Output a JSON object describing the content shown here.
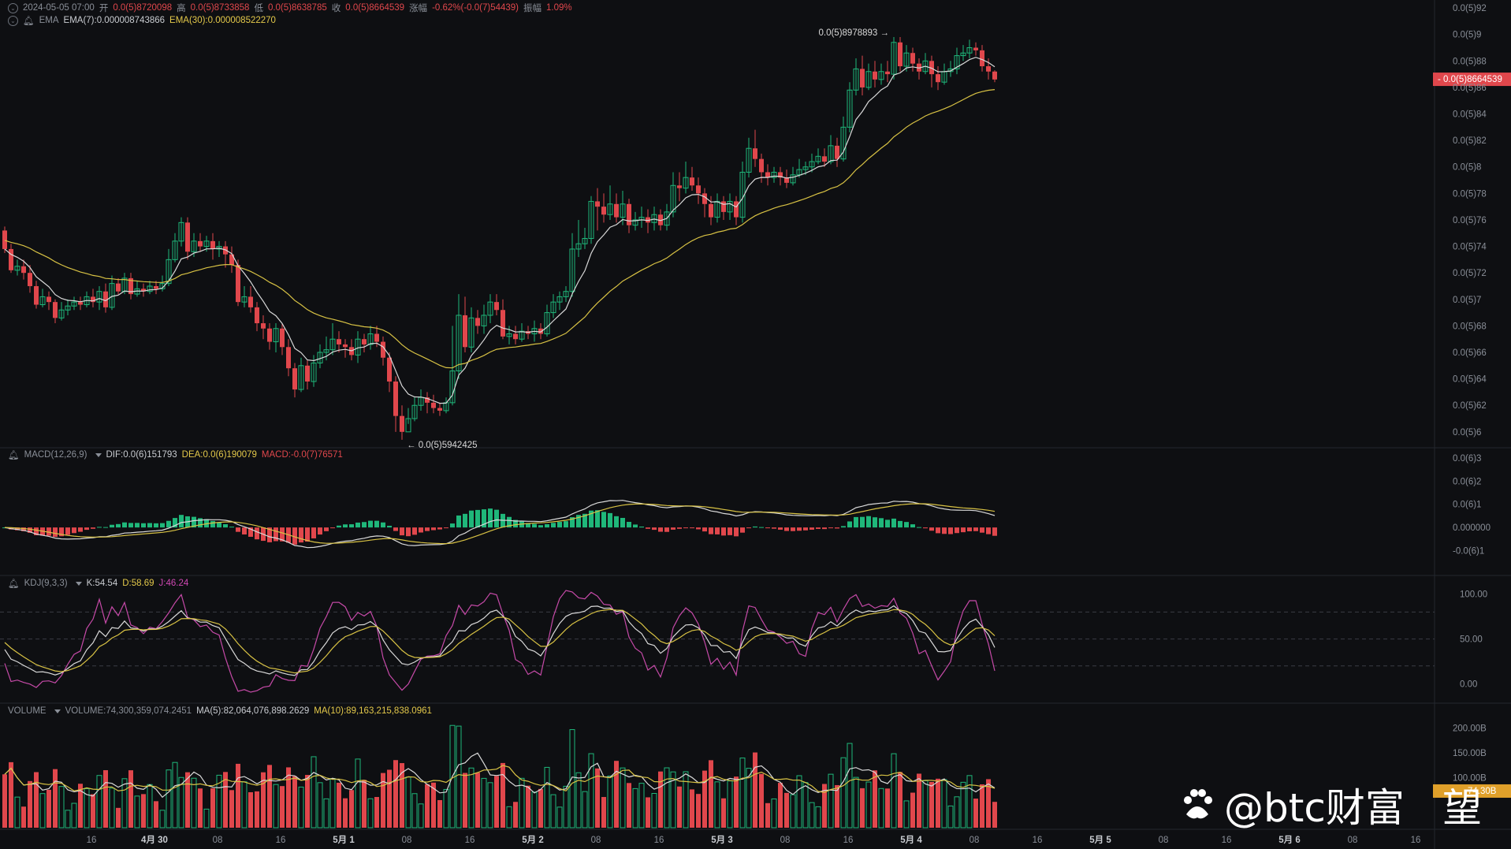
{
  "colors": {
    "bg": "#0e0f12",
    "up": "#1fb77a",
    "down": "#e0474c",
    "ema7": "#d9d9d9",
    "ema30": "#d8c244",
    "grid": "#1e2026",
    "axis": "#8a8f98",
    "dif": "#d9d9d9",
    "dea": "#d8c244",
    "k": "#d9d9d9",
    "d": "#d8c244",
    "j": "#c64aa8",
    "tag_bg": "#e0474c",
    "tag2_bg": "#e0a02a"
  },
  "header": {
    "line1": {
      "date": "2024-05-05 07:00",
      "open_label": "开",
      "open": "0.0(5)8720098",
      "high_label": "高",
      "high": "0.0(5)8733858",
      "low_label": "低",
      "low": "0.0(5)8638785",
      "close_label": "收",
      "close": "0.0(5)8664539",
      "chg_label": "涨幅",
      "chg": "-0.62%(-0.0(7)54439)",
      "amp_label": "振幅",
      "amp": "1.09%"
    },
    "line2": {
      "name": "EMA",
      "ema7": "EMA(7):0.000008743866",
      "ema30": "EMA(30):0.000008522270"
    }
  },
  "price_axis": {
    "labels": [
      "0.0(5)92",
      "0.0(5)9",
      "0.0(5)88",
      "0.0(5)86",
      "0.0(5)84",
      "0.0(5)82",
      "0.0(5)8",
      "0.0(5)78",
      "0.0(5)76",
      "0.0(5)74",
      "0.0(5)72",
      "0.0(5)7",
      "0.0(5)68",
      "0.0(5)66",
      "0.0(5)64",
      "0.0(5)62",
      "0.0(5)6"
    ],
    "values": [
      9.2,
      9.0,
      8.8,
      8.6,
      8.4,
      8.2,
      8.0,
      7.8,
      7.6,
      7.4,
      7.2,
      7.0,
      6.8,
      6.6,
      6.4,
      6.2,
      6.0
    ],
    "range": [
      5.88,
      9.26
    ],
    "current_tag": "- 0.0(5)8664539",
    "current_value": 8.664539,
    "max_label": "0.0(5)8978893",
    "max_value": 8.978893,
    "min_label": "← 0.0(5)5942425",
    "min_value": 5.942425
  },
  "macd": {
    "title": "MACD(12,26,9)",
    "dif": "DIF:0.0(6)151793",
    "dea": "DEA:0.0(6)190079",
    "macd": "MACD:-0.0(7)76571",
    "axis_labels": [
      "0.0(6)3",
      "0.0(6)2",
      "0.0(6)1",
      "0.000000",
      "-0.0(6)1"
    ],
    "axis_values": [
      3,
      2,
      1,
      0,
      -1
    ],
    "range": [
      -1.9,
      3.2
    ]
  },
  "kdj": {
    "title": "KDJ(9,3,3)",
    "k": "K:54.54",
    "d": "D:58.69",
    "j": "J:46.24",
    "axis_labels": [
      "100.00",
      "50.00",
      "0.00"
    ],
    "axis_values": [
      100,
      50,
      0
    ],
    "range": [
      -18,
      112
    ]
  },
  "volume": {
    "title": "VOLUME",
    "vol": "VOLUME:74,300,359,074.2451",
    "ma5": "MA(5):82,064,076,898.2629",
    "ma10": "MA(10):89,163,215,838.0961",
    "axis_labels": [
      "200.00B",
      "150.00B",
      "100.00B"
    ],
    "axis_values": [
      200,
      150,
      100
    ],
    "range": [
      0,
      218
    ],
    "tag": "74.30B"
  },
  "time_axis": {
    "labels": [
      "16",
      "4月 30",
      "08",
      "16",
      "5月 1",
      "08",
      "16",
      "5月 2",
      "08",
      "16",
      "5月 3",
      "08",
      "16",
      "5月 4",
      "08",
      "16",
      "5月 5",
      "08",
      "16",
      "5月 6",
      "08",
      "16"
    ],
    "bold": [
      false,
      true,
      false,
      false,
      true,
      false,
      false,
      true,
      false,
      false,
      true,
      false,
      false,
      true,
      false,
      false,
      true,
      false,
      false,
      true,
      false,
      false
    ]
  },
  "watermark": {
    "text": "@btc财富",
    "tail": "望"
  },
  "chart_data": {
    "type": "candlestick",
    "interval_hours": 2,
    "candles": [
      [
        7.52,
        7.38,
        7.55,
        7.35
      ],
      [
        7.38,
        7.22,
        7.42,
        7.2
      ],
      [
        7.22,
        7.25,
        7.3,
        7.18
      ],
      [
        7.25,
        7.2,
        7.3,
        7.15
      ],
      [
        7.2,
        7.1,
        7.26,
        7.05
      ],
      [
        7.1,
        6.96,
        7.14,
        6.93
      ],
      [
        6.96,
        7.02,
        7.08,
        6.94
      ],
      [
        7.02,
        6.98,
        7.06,
        6.92
      ],
      [
        6.98,
        6.86,
        7.0,
        6.82
      ],
      [
        6.86,
        6.92,
        6.98,
        6.84
      ],
      [
        6.92,
        6.95,
        7.0,
        6.88
      ],
      [
        6.95,
        6.98,
        7.02,
        6.92
      ],
      [
        6.98,
        6.96,
        7.02,
        6.92
      ],
      [
        6.96,
        7.02,
        7.06,
        6.94
      ],
      [
        7.02,
        6.98,
        7.08,
        6.94
      ],
      [
        6.98,
        7.06,
        7.1,
        6.92
      ],
      [
        7.06,
        6.94,
        7.12,
        6.9
      ],
      [
        6.94,
        7.12,
        7.18,
        6.92
      ],
      [
        7.12,
        7.06,
        7.16,
        7.04
      ],
      [
        7.06,
        7.16,
        7.2,
        7.04
      ],
      [
        7.16,
        7.04,
        7.2,
        7.0
      ],
      [
        7.04,
        7.08,
        7.14,
        7.02
      ],
      [
        7.08,
        7.06,
        7.12,
        7.02
      ],
      [
        7.06,
        7.1,
        7.14,
        7.04
      ],
      [
        7.1,
        7.08,
        7.14,
        7.04
      ],
      [
        7.08,
        7.12,
        7.18,
        7.06
      ],
      [
        7.12,
        7.3,
        7.38,
        7.1
      ],
      [
        7.3,
        7.44,
        7.5,
        7.28
      ],
      [
        7.44,
        7.58,
        7.62,
        7.4
      ],
      [
        7.58,
        7.36,
        7.62,
        7.3
      ],
      [
        7.36,
        7.44,
        7.5,
        7.32
      ],
      [
        7.44,
        7.4,
        7.5,
        7.36
      ],
      [
        7.4,
        7.44,
        7.48,
        7.36
      ],
      [
        7.44,
        7.38,
        7.5,
        7.3
      ],
      [
        7.38,
        7.4,
        7.44,
        7.32
      ],
      [
        7.4,
        7.34,
        7.44,
        7.24
      ],
      [
        7.34,
        7.26,
        7.4,
        7.2
      ],
      [
        7.26,
        6.98,
        7.3,
        6.95
      ],
      [
        6.98,
        7.02,
        7.1,
        6.94
      ],
      [
        7.02,
        6.94,
        7.1,
        6.9
      ],
      [
        6.94,
        6.82,
        6.98,
        6.76
      ],
      [
        6.82,
        6.78,
        6.88,
        6.7
      ],
      [
        6.78,
        6.68,
        6.82,
        6.62
      ],
      [
        6.68,
        6.78,
        6.82,
        6.6
      ],
      [
        6.78,
        6.64,
        6.82,
        6.58
      ],
      [
        6.64,
        6.48,
        6.7,
        6.42
      ],
      [
        6.48,
        6.32,
        6.52,
        6.26
      ],
      [
        6.32,
        6.5,
        6.56,
        6.3
      ],
      [
        6.5,
        6.38,
        6.54,
        6.32
      ],
      [
        6.38,
        6.52,
        6.58,
        6.34
      ],
      [
        6.52,
        6.6,
        6.66,
        6.48
      ],
      [
        6.6,
        6.62,
        6.72,
        6.54
      ],
      [
        6.62,
        6.7,
        6.82,
        6.58
      ],
      [
        6.7,
        6.66,
        6.76,
        6.6
      ],
      [
        6.66,
        6.64,
        6.7,
        6.56
      ],
      [
        6.64,
        6.58,
        6.7,
        6.54
      ],
      [
        6.58,
        6.7,
        6.76,
        6.52
      ],
      [
        6.7,
        6.66,
        6.74,
        6.6
      ],
      [
        6.66,
        6.74,
        6.8,
        6.62
      ],
      [
        6.74,
        6.68,
        6.8,
        6.64
      ],
      [
        6.68,
        6.56,
        6.72,
        6.5
      ],
      [
        6.56,
        6.38,
        6.6,
        6.3
      ],
      [
        6.38,
        6.12,
        6.42,
        6.0
      ],
      [
        6.12,
        6.0,
        6.2,
        5.94
      ],
      [
        6.0,
        6.1,
        6.18,
        6.06
      ],
      [
        6.1,
        6.2,
        6.26,
        6.08
      ],
      [
        6.2,
        6.26,
        6.32,
        6.16
      ],
      [
        6.26,
        6.22,
        6.3,
        6.14
      ],
      [
        6.22,
        6.18,
        6.28,
        6.14
      ],
      [
        6.18,
        6.16,
        6.22,
        6.12
      ],
      [
        6.16,
        6.22,
        6.26,
        6.14
      ],
      [
        6.22,
        6.46,
        6.8,
        6.2
      ],
      [
        6.46,
        6.88,
        7.04,
        6.4
      ],
      [
        6.88,
        6.64,
        7.02,
        6.6
      ],
      [
        6.64,
        6.86,
        6.94,
        6.6
      ],
      [
        6.86,
        6.8,
        6.92,
        6.74
      ],
      [
        6.8,
        6.88,
        6.96,
        6.74
      ],
      [
        6.88,
        6.98,
        7.04,
        6.82
      ],
      [
        6.98,
        6.92,
        7.04,
        6.88
      ],
      [
        6.92,
        6.72,
        7.0,
        6.7
      ],
      [
        6.72,
        6.74,
        6.8,
        6.66
      ],
      [
        6.74,
        6.7,
        6.8,
        6.66
      ],
      [
        6.7,
        6.76,
        6.82,
        6.68
      ],
      [
        6.76,
        6.74,
        6.8,
        6.7
      ],
      [
        6.74,
        6.78,
        6.84,
        6.68
      ],
      [
        6.78,
        6.74,
        6.82,
        6.7
      ],
      [
        6.74,
        6.9,
        6.96,
        6.72
      ],
      [
        6.9,
        6.98,
        7.04,
        6.86
      ],
      [
        6.98,
        7.02,
        7.06,
        6.92
      ],
      [
        7.02,
        7.06,
        7.1,
        6.98
      ],
      [
        7.06,
        7.38,
        7.5,
        7.02
      ],
      [
        7.38,
        7.42,
        7.6,
        7.32
      ],
      [
        7.42,
        7.46,
        7.54,
        7.38
      ],
      [
        7.46,
        7.74,
        7.78,
        7.42
      ],
      [
        7.74,
        7.7,
        7.84,
        7.52
      ],
      [
        7.7,
        7.64,
        7.8,
        7.58
      ],
      [
        7.64,
        7.72,
        7.86,
        7.6
      ],
      [
        7.72,
        7.62,
        7.8,
        7.58
      ],
      [
        7.62,
        7.72,
        7.82,
        7.56
      ],
      [
        7.72,
        7.56,
        7.76,
        7.5
      ],
      [
        7.56,
        7.6,
        7.66,
        7.52
      ],
      [
        7.6,
        7.62,
        7.7,
        7.54
      ],
      [
        7.62,
        7.58,
        7.68,
        7.5
      ],
      [
        7.58,
        7.64,
        7.7,
        7.52
      ],
      [
        7.64,
        7.56,
        7.68,
        7.52
      ],
      [
        7.56,
        7.66,
        7.72,
        7.52
      ],
      [
        7.66,
        7.86,
        7.96,
        7.62
      ],
      [
        7.86,
        7.84,
        7.96,
        7.74
      ],
      [
        7.84,
        7.92,
        8.04,
        7.8
      ],
      [
        7.92,
        7.86,
        8.0,
        7.82
      ],
      [
        7.86,
        7.8,
        7.92,
        7.72
      ],
      [
        7.8,
        7.72,
        7.84,
        7.62
      ],
      [
        7.72,
        7.62,
        7.78,
        7.56
      ],
      [
        7.62,
        7.74,
        7.8,
        7.58
      ],
      [
        7.74,
        7.66,
        7.78,
        7.6
      ],
      [
        7.66,
        7.74,
        7.8,
        7.6
      ],
      [
        7.74,
        7.62,
        7.78,
        7.56
      ],
      [
        7.62,
        7.96,
        8.04,
        7.58
      ],
      [
        7.96,
        8.14,
        8.22,
        7.92
      ],
      [
        8.14,
        8.06,
        8.28,
        8.0
      ],
      [
        8.06,
        7.96,
        8.1,
        7.88
      ],
      [
        7.96,
        7.92,
        8.02,
        7.86
      ],
      [
        7.92,
        7.96,
        8.0,
        7.88
      ],
      [
        7.96,
        7.92,
        8.0,
        7.86
      ],
      [
        7.92,
        7.88,
        7.98,
        7.84
      ],
      [
        7.88,
        7.94,
        8.0,
        7.86
      ],
      [
        7.94,
        7.98,
        8.06,
        7.92
      ],
      [
        7.98,
        8.0,
        8.04,
        7.94
      ],
      [
        8.0,
        8.04,
        8.1,
        7.96
      ],
      [
        8.04,
        8.08,
        8.14,
        8.02
      ],
      [
        8.08,
        8.04,
        8.14,
        8.0
      ],
      [
        8.04,
        8.16,
        8.24,
        8.02
      ],
      [
        8.16,
        8.06,
        8.22,
        8.0
      ],
      [
        8.06,
        8.3,
        8.38,
        8.04
      ],
      [
        8.3,
        8.58,
        8.64,
        8.26
      ],
      [
        8.58,
        8.74,
        8.82,
        8.54
      ],
      [
        8.74,
        8.6,
        8.84,
        8.54
      ],
      [
        8.6,
        8.72,
        8.78,
        8.58
      ],
      [
        8.72,
        8.66,
        8.8,
        8.6
      ],
      [
        8.66,
        8.72,
        8.78,
        8.62
      ],
      [
        8.72,
        8.7,
        8.8,
        8.64
      ],
      [
        8.7,
        8.94,
        8.98,
        8.66
      ],
      [
        8.94,
        8.76,
        8.98,
        8.72
      ],
      [
        8.76,
        8.86,
        8.92,
        8.72
      ],
      [
        8.86,
        8.78,
        8.9,
        8.72
      ],
      [
        8.78,
        8.72,
        8.82,
        8.66
      ],
      [
        8.72,
        8.8,
        8.86,
        8.7
      ],
      [
        8.8,
        8.7,
        8.84,
        8.6
      ],
      [
        8.7,
        8.64,
        8.76,
        8.58
      ],
      [
        8.64,
        8.72,
        8.78,
        8.62
      ],
      [
        8.72,
        8.74,
        8.8,
        8.68
      ],
      [
        8.74,
        8.84,
        8.9,
        8.7
      ],
      [
        8.84,
        8.86,
        8.92,
        8.8
      ],
      [
        8.86,
        8.9,
        8.96,
        8.82
      ],
      [
        8.9,
        8.88,
        8.94,
        8.84
      ],
      [
        8.88,
        8.76,
        8.92,
        8.72
      ],
      [
        8.76,
        8.72,
        8.82,
        8.66
      ],
      [
        8.72,
        8.66,
        8.73,
        8.64
      ]
    ],
    "series": [
      {
        "name": "EMA(7)",
        "values": "computed"
      },
      {
        "name": "EMA(30)",
        "values": "computed"
      }
    ]
  }
}
